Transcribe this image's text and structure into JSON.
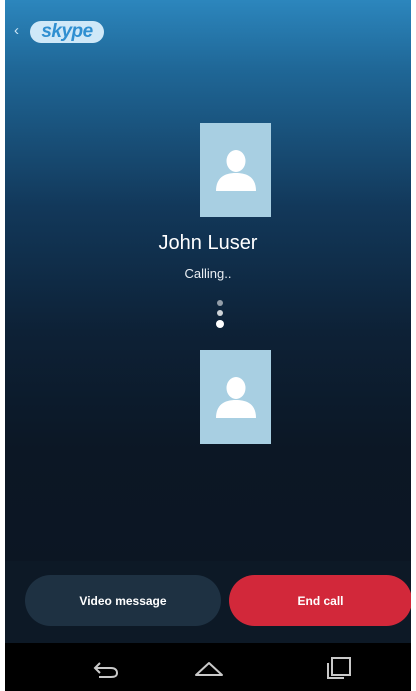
{
  "header": {
    "back_chevron": "‹",
    "logo_text": "skype",
    "logo_icon": "skype-logo-icon"
  },
  "call": {
    "contact_name": "John Luser",
    "status": "Calling..",
    "remote_avatar_icon": "person-icon",
    "local_avatar_icon": "person-icon",
    "progress_icon": "three-dots-vertical-icon"
  },
  "actions": {
    "video_message_label": "Video message",
    "end_call_label": "End call"
  },
  "navbar": {
    "back_icon": "back-arrow-icon",
    "home_icon": "home-icon",
    "recent_icon": "recent-apps-icon"
  },
  "colors": {
    "end_call": "#d2283a",
    "video_message": "#1e3142",
    "avatar_bg": "#a8cfe2",
    "skype_blue": "#2f8fd1"
  }
}
